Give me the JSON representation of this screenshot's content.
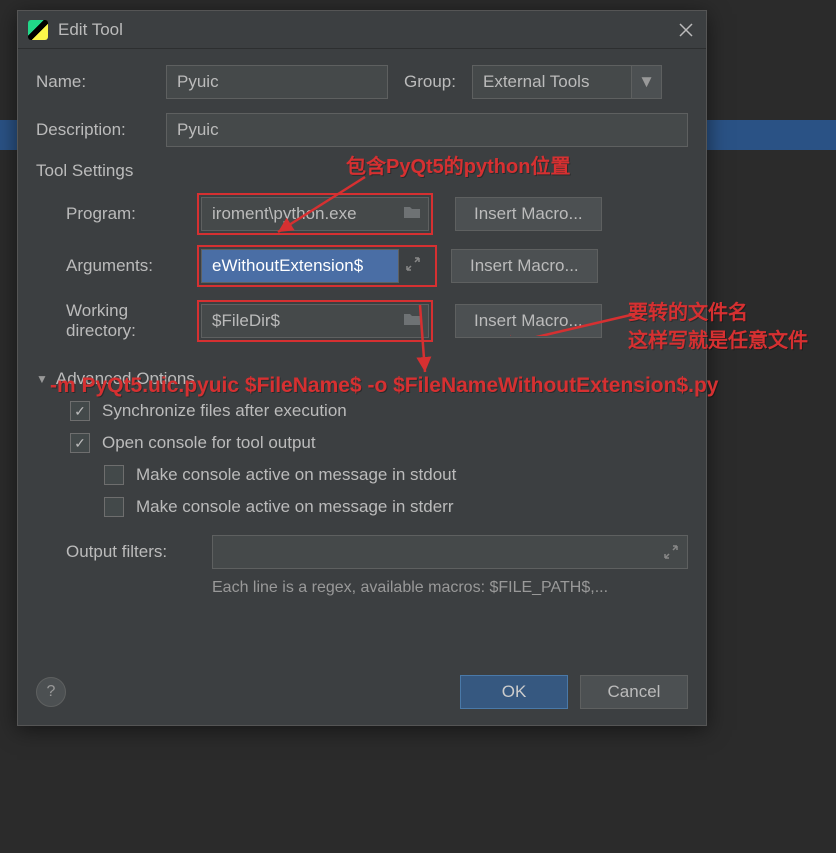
{
  "window": {
    "title": "Edit Tool"
  },
  "fields": {
    "name_label": "Name:",
    "name_value": "Pyuic",
    "group_label": "Group:",
    "group_value": "External Tools",
    "desc_label": "Description:",
    "desc_value": "Pyuic"
  },
  "tool_settings": {
    "heading": "Tool Settings",
    "program_label": "Program:",
    "program_value": "iroment\\python.exe",
    "arguments_label": "Arguments:",
    "arguments_value": "eWithoutExtension$.py",
    "wd_label": "Working directory:",
    "wd_value": "$FileDir$",
    "insert_macro": "Insert Macro..."
  },
  "advanced": {
    "heading": "Advanced Options",
    "sync": "Synchronize files after execution",
    "console": "Open console for tool output",
    "stdout": "Make console active on message in stdout",
    "stderr": "Make console active on message in stderr",
    "output_label": "Output filters:",
    "hint": "Each line is a regex, available macros: $FILE_PATH$,..."
  },
  "buttons": {
    "ok": "OK",
    "cancel": "Cancel",
    "help": "?"
  },
  "annotations": {
    "anno1": "包含PyQt5的python位置",
    "anno2": "要转的文件名",
    "anno3": "这样写就是任意文件",
    "anno4": "-m PyQt5.uic.pyuic $FileName$ -o $FileNameWithoutExtension$.py"
  }
}
